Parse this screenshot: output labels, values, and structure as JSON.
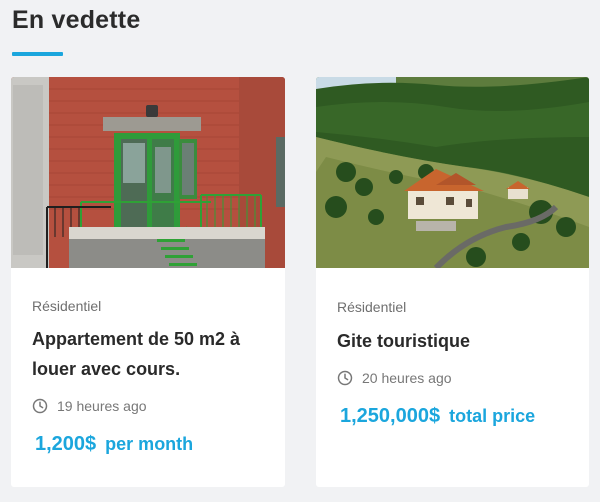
{
  "section": {
    "title": "En vedette"
  },
  "listings": [
    {
      "category": "Résidentiel",
      "title": "Appartement de 50 m2 à louer avec cours.",
      "time": "19 heures ago",
      "price": "1,200$",
      "price_unit": "per month"
    },
    {
      "category": "Résidentiel",
      "title": "Gite touristique",
      "time": "20 heures ago",
      "price": "1,250,000$",
      "price_unit": "total price"
    }
  ],
  "colors": {
    "accent": "#1ba6dd",
    "background": "#f1f2f4",
    "card": "#ffffff"
  },
  "icons": {
    "time": "clock-icon"
  }
}
